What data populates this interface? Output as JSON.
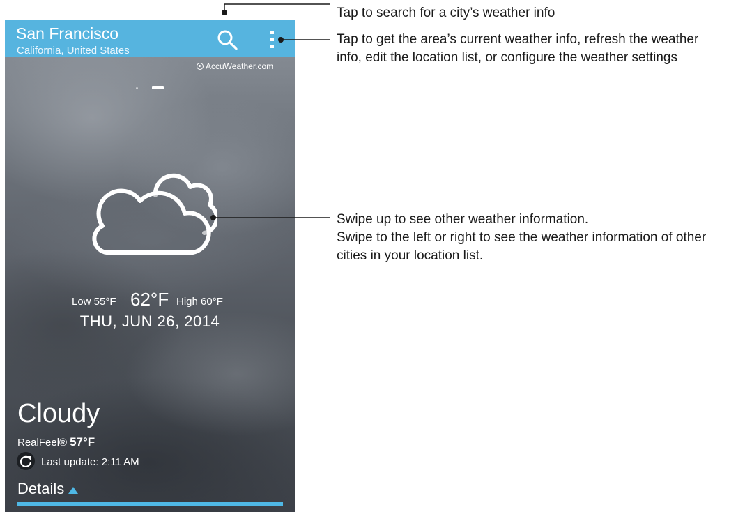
{
  "app_bar": {
    "city": "San Francisco",
    "region": "California, United States",
    "search_icon": "search-icon",
    "menu_icon": "more-vert-icon"
  },
  "provider": {
    "label": "AccuWeather.com"
  },
  "pager": {
    "pages": 2,
    "current": 2
  },
  "weather": {
    "icon": "cloudy-icon",
    "low": "Low 55°F",
    "current": "62°F",
    "high": "High 60°F",
    "date": "THU, JUN 26, 2014",
    "condition": "Cloudy",
    "realfeel_label": "RealFeel®",
    "realfeel_value": "57°F",
    "last_update": "Last update: 2:11 AM"
  },
  "details": {
    "label": "Details"
  },
  "callouts": {
    "search": "Tap to search for a city’s weather info",
    "menu": "Tap to get the area’s current weather info, refresh the weather info, edit the location list, or configure the weather settings",
    "swipe_line1": "Swipe up to see other weather information.",
    "swipe_line2": "Swipe to the left or right to see the weather information of other cities in your location list."
  },
  "colors": {
    "app_bar": "#56b4df",
    "accent": "#4fb8e6",
    "callout_line": "#1a1a1a"
  }
}
